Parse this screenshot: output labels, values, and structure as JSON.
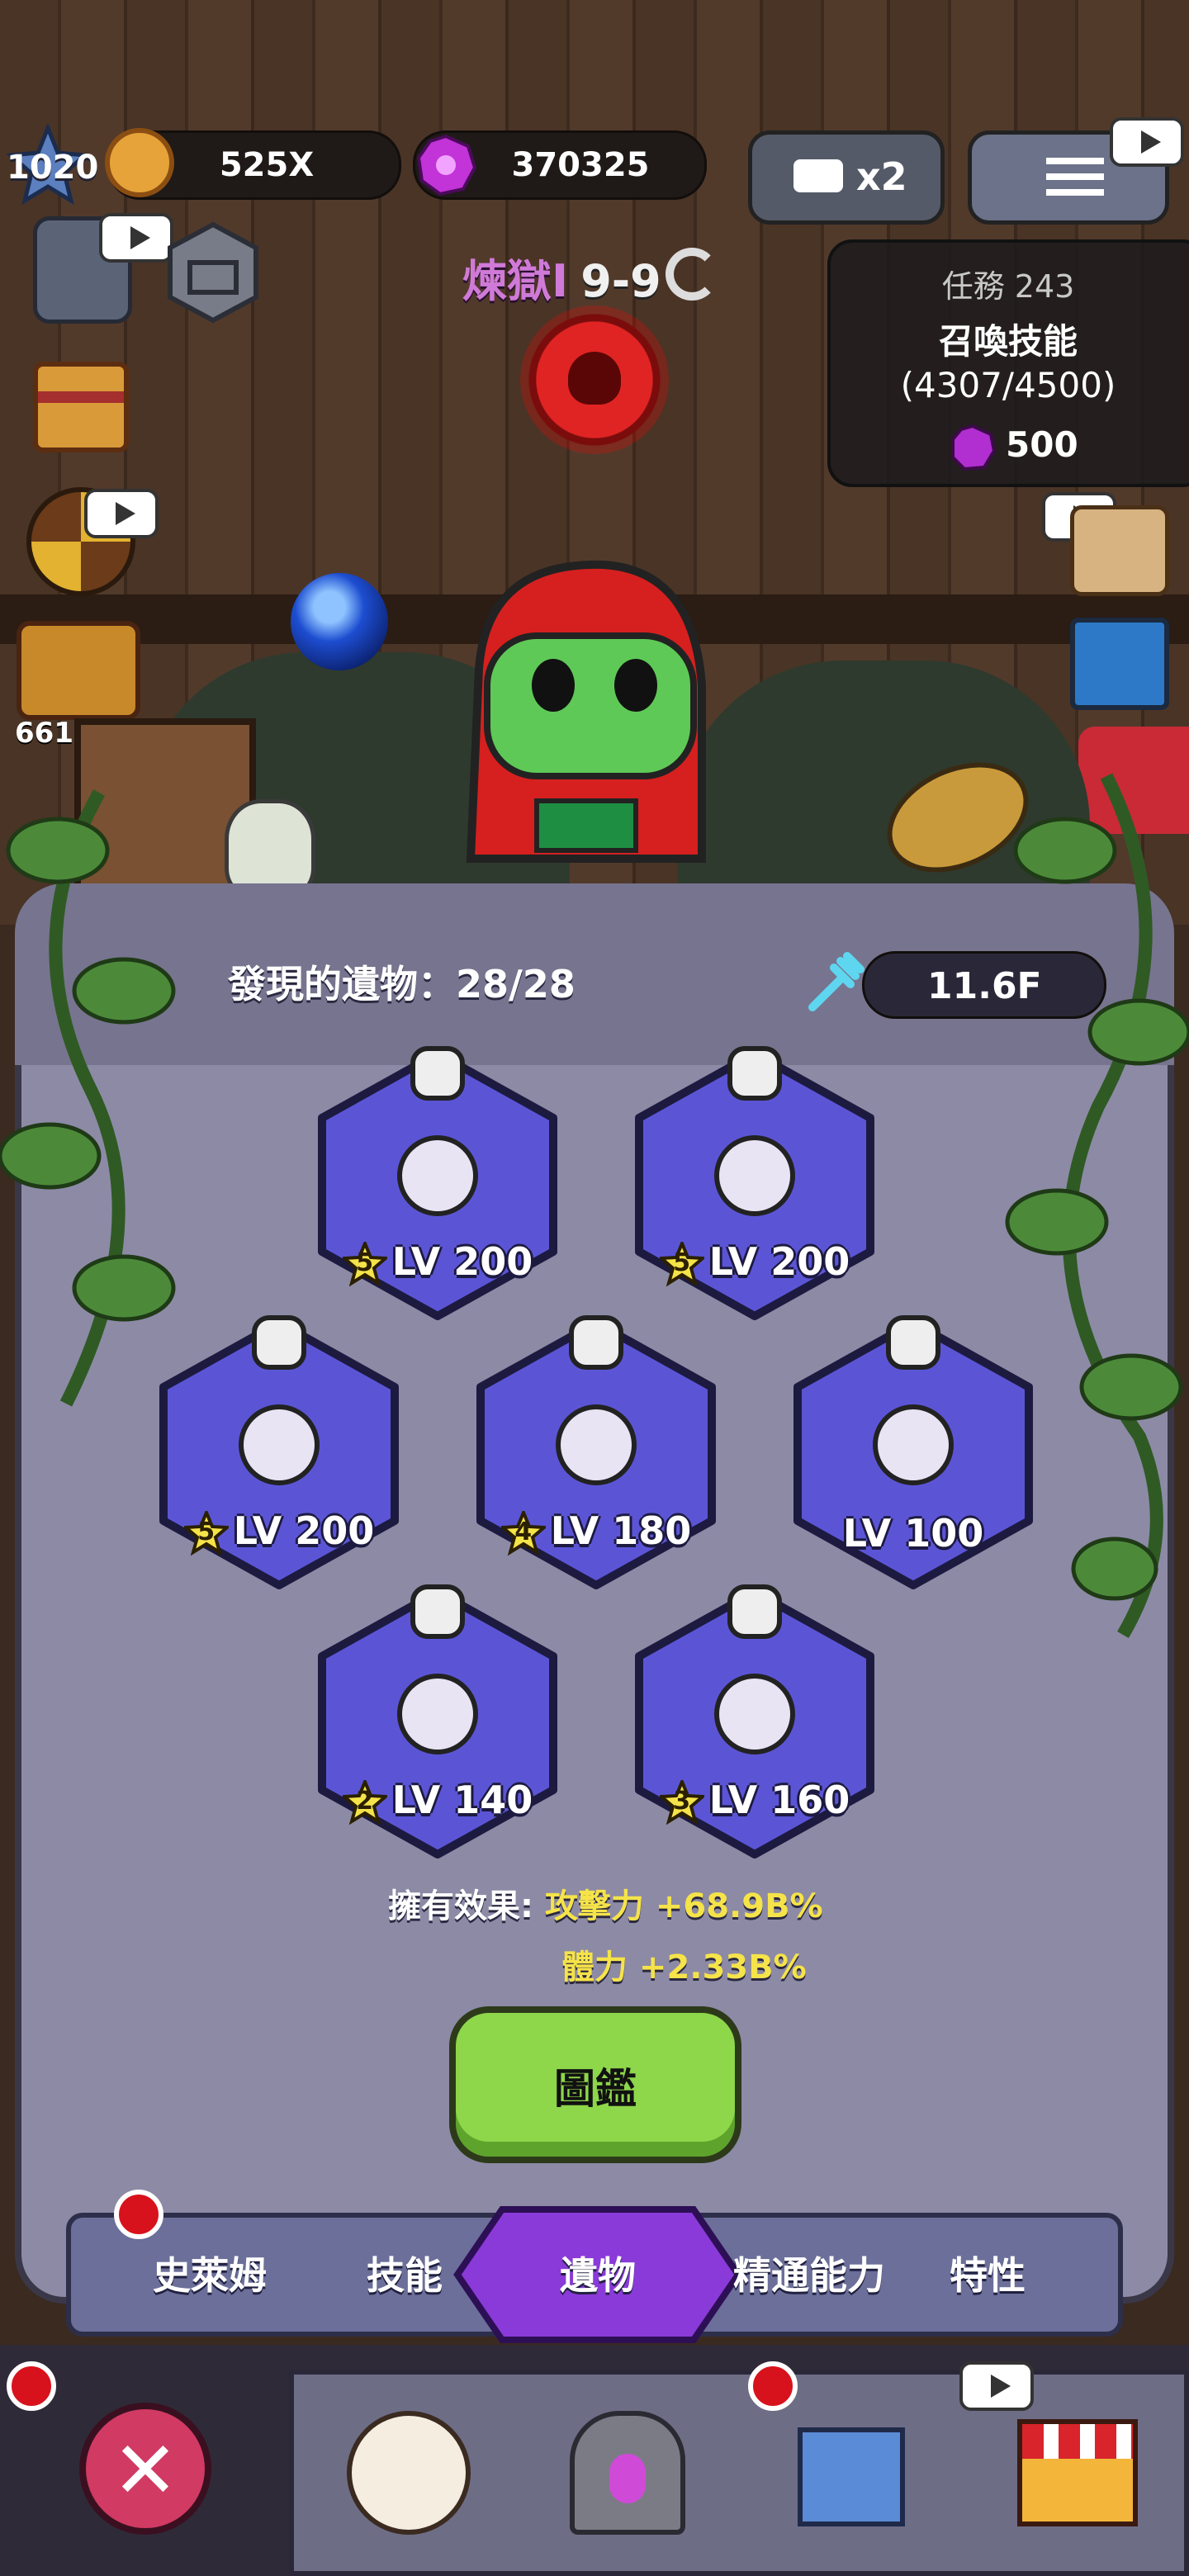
{
  "hud": {
    "level": "1020",
    "coins": "525X",
    "gems": "370325",
    "speed_label": "x2",
    "side_count": "661"
  },
  "stage": {
    "name": "煉獄I",
    "number": "9-9"
  },
  "quest": {
    "title": "任務 243",
    "name": "召喚技能",
    "progress": "(4307/4500)",
    "reward": "500"
  },
  "relics": {
    "found_label": "發現的遺物：28/28",
    "floor": "11.6F",
    "items": [
      {
        "name": "potion",
        "stars": "5",
        "level": "LV 200"
      },
      {
        "name": "crystal-orb",
        "stars": "5",
        "level": "LV 200"
      },
      {
        "name": "lucky-cat",
        "stars": "5",
        "level": "LV 200"
      },
      {
        "name": "gold-coins",
        "stars": "4",
        "level": "LV 180"
      },
      {
        "name": "ring",
        "stars": "",
        "level": "LV 100"
      },
      {
        "name": "fox-mask",
        "stars": "2",
        "level": "LV 140"
      },
      {
        "name": "magic-book",
        "stars": "3",
        "level": "LV 160"
      }
    ],
    "effects_label": "擁有效果:",
    "effect1": "攻擊力 +68.9B%",
    "effect2": "體力 +2.33B%",
    "codex_button": "圖鑑"
  },
  "tabs": [
    "史萊姆",
    "技能",
    "遺物",
    "精通能力",
    "特性"
  ],
  "colors": {
    "hex_fill": "#5b55d6",
    "accent_yellow": "#f5e34a",
    "button_green": "#8ed64a",
    "active_tab": "#8a3ad8"
  }
}
